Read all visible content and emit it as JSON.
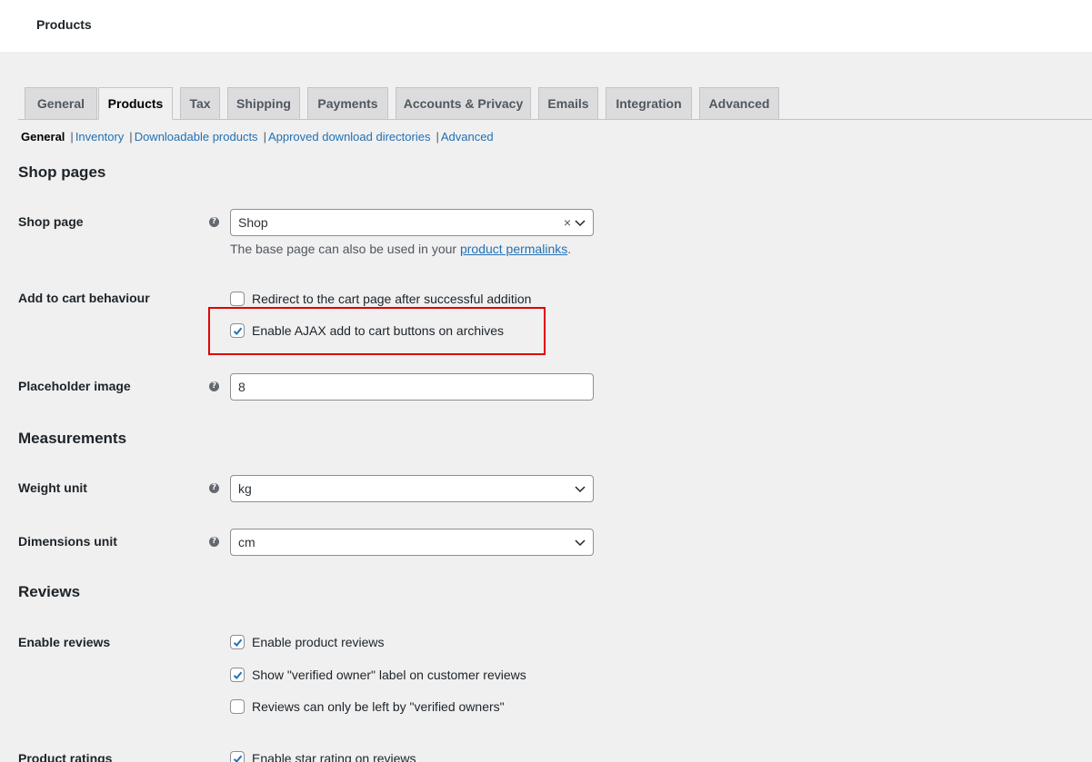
{
  "header": {
    "title": "Products"
  },
  "tabs": [
    {
      "label": "General",
      "active": false
    },
    {
      "label": "Products",
      "active": true
    },
    {
      "label": "Tax",
      "active": false
    },
    {
      "label": "Shipping",
      "active": false
    },
    {
      "label": "Payments",
      "active": false
    },
    {
      "label": "Accounts & Privacy",
      "active": false
    },
    {
      "label": "Emails",
      "active": false
    },
    {
      "label": "Integration",
      "active": false
    },
    {
      "label": "Advanced",
      "active": false
    }
  ],
  "subnav": {
    "current": "General",
    "links": [
      "Inventory",
      "Downloadable products",
      "Approved download directories",
      "Advanced"
    ]
  },
  "shop_pages": {
    "title": "Shop pages",
    "shop_page": {
      "label": "Shop page",
      "value": "Shop",
      "desc_prefix": "The base page can also be used in your ",
      "desc_link": "product permalinks",
      "desc_suffix": "."
    },
    "add_to_cart": {
      "label": "Add to cart behaviour",
      "options": [
        {
          "label": "Redirect to the cart page after successful addition",
          "checked": false
        },
        {
          "label": "Enable AJAX add to cart buttons on archives",
          "checked": true
        }
      ]
    },
    "placeholder": {
      "label": "Placeholder image",
      "value": "8"
    }
  },
  "measurements": {
    "title": "Measurements",
    "weight": {
      "label": "Weight unit",
      "value": "kg"
    },
    "dimensions": {
      "label": "Dimensions unit",
      "value": "cm"
    }
  },
  "reviews": {
    "title": "Reviews",
    "enable": {
      "label": "Enable reviews",
      "options": [
        {
          "label": "Enable product reviews",
          "checked": true
        },
        {
          "label": "Show \"verified owner\" label on customer reviews",
          "checked": true
        },
        {
          "label": "Reviews can only be left by \"verified owners\"",
          "checked": false
        }
      ]
    },
    "ratings": {
      "label": "Product ratings",
      "options": [
        {
          "label": "Enable star rating on reviews",
          "checked": true
        }
      ]
    }
  },
  "colors": {
    "accent": "#2271b1",
    "highlight": "#e00000"
  }
}
